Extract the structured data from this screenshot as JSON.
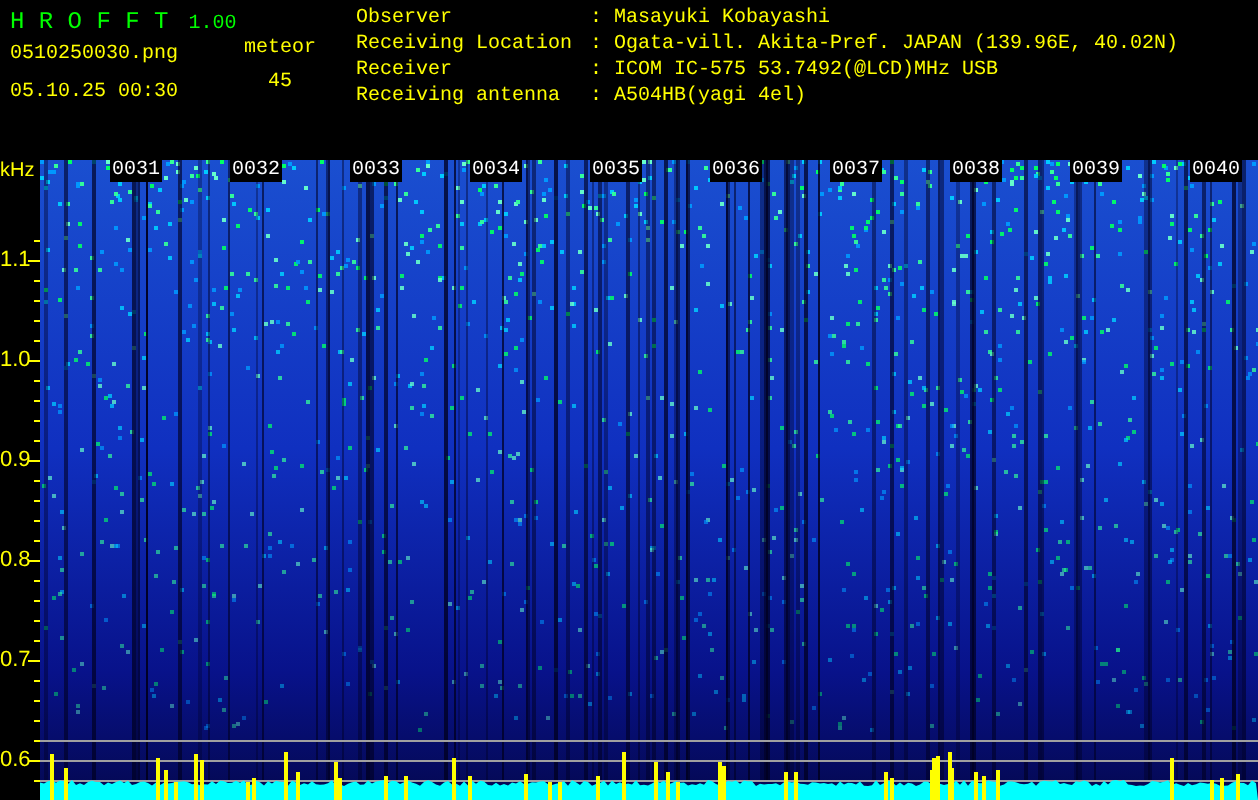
{
  "app": {
    "title": "H R O F F T",
    "version": "1.00"
  },
  "file": {
    "name": "0510250030.png",
    "datetime": "05.10.25 00:30"
  },
  "meteor": {
    "label": "meteor",
    "count": "45"
  },
  "info": [
    {
      "label": "Observer",
      "value": "Masayuki Kobayashi"
    },
    {
      "label": "Receiving Location",
      "value": "Ogata-vill. Akita-Pref. JAPAN (139.96E, 40.02N)"
    },
    {
      "label": "Receiver",
      "value": "ICOM IC-575 53.7492(@LCD)MHz USB"
    },
    {
      "label": "Receiving antenna",
      "value": "A504HB(yagi 4el)"
    }
  ],
  "separator": ":",
  "y_axis": {
    "unit": "kHz",
    "labels": [
      "1.1",
      "1.0",
      "0.9",
      "0.8",
      "0.7",
      "0.6"
    ]
  },
  "time_labels": [
    "0031",
    "0032",
    "0033",
    "0034",
    "0035",
    "0036",
    "0037",
    "0038",
    "0039",
    "0040"
  ]
}
